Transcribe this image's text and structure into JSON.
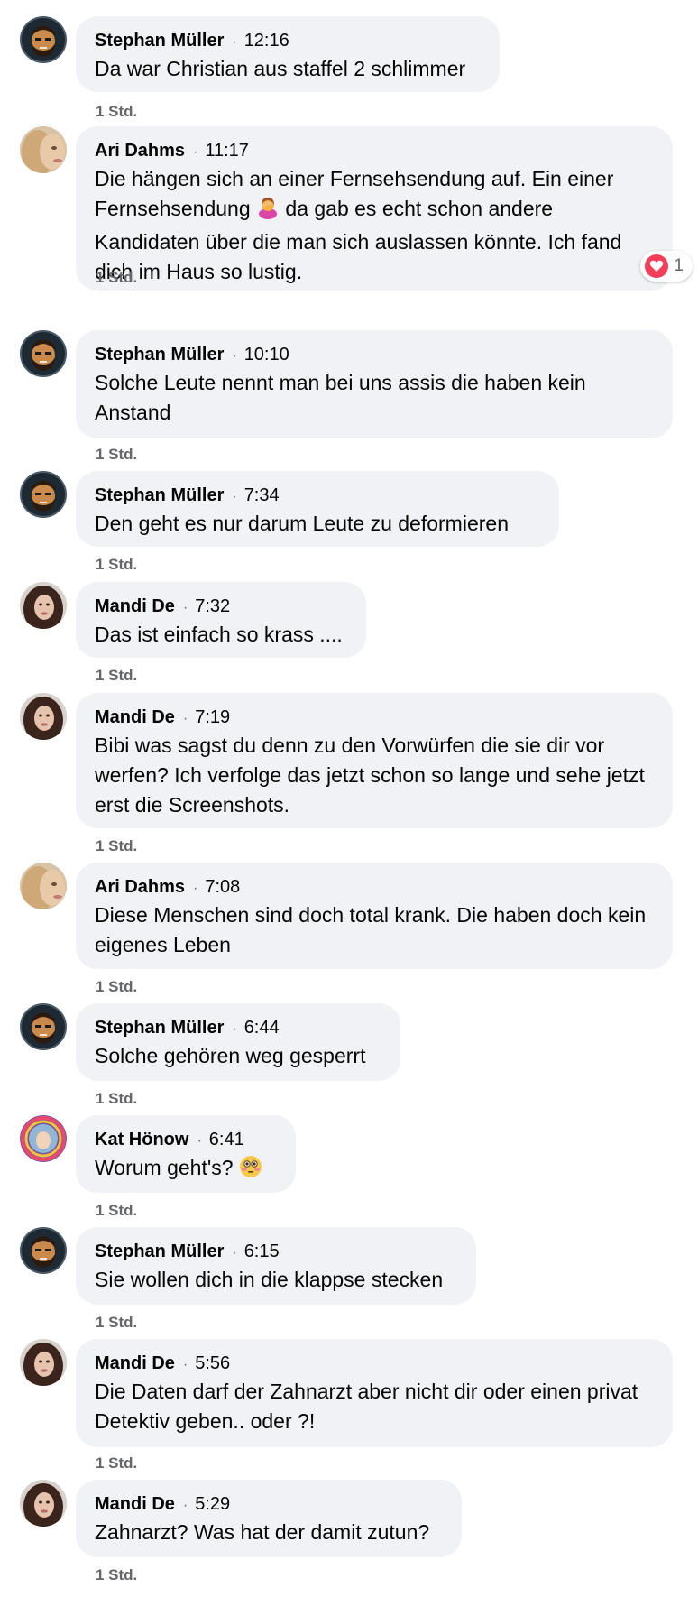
{
  "comments": [
    {
      "author": "Stephan Müller",
      "time": "12:16",
      "text": "Da war Christian aus staffel 2 schlimmer",
      "meta": "1 Std.",
      "avatar": "cartoon-man"
    },
    {
      "author": "Ari Dahms",
      "time": "11:17",
      "text_a": "Die hängen sich an einer Fernsehsendung auf. Ein einer Fernsehsendung ",
      "emoji": "woman-facepalming",
      "text_b": " da gab es echt schon andere Kandidaten über die man sich auslassen könnte. Ich fand dich im Haus so lustig.",
      "meta": "1 Std.",
      "reaction_count": "1",
      "avatar": "blonde-woman"
    },
    {
      "author": "Stephan Müller",
      "time": "10:10",
      "text": "Solche Leute nennt man bei uns assis die haben kein Anstand",
      "meta": "1 Std.",
      "avatar": "cartoon-man"
    },
    {
      "author": "Stephan Müller",
      "time": "7:34",
      "text": "Den geht es nur darum Leute zu deformieren",
      "meta": "1 Std.",
      "avatar": "cartoon-man"
    },
    {
      "author": "Mandi De",
      "time": "7:32",
      "text": "Das ist einfach so krass ....",
      "meta": "1 Std.",
      "avatar": "dark-hair-woman"
    },
    {
      "author": "Mandi De",
      "time": "7:19",
      "text": "Bibi was sagst du denn zu den Vorwürfen die sie dir vor werfen? Ich verfolge das jetzt schon so lange und sehe jetzt erst die Screenshots.",
      "meta": "1 Std.",
      "avatar": "dark-hair-woman"
    },
    {
      "author": "Ari Dahms",
      "time": "7:08",
      "text": "Diese Menschen sind doch total krank. Die haben doch kein eigenes Leben",
      "meta": "1 Std.",
      "avatar": "blonde-woman"
    },
    {
      "author": "Stephan Müller",
      "time": "6:44",
      "text": "Solche gehören weg gesperrt",
      "meta": "1 Std.",
      "avatar": "cartoon-man"
    },
    {
      "author": "Kat Hönow",
      "time": "6:41",
      "text": "Worum geht's?",
      "emoji": "flushed-face",
      "meta": "1 Std.",
      "avatar": "colorful-ring"
    },
    {
      "author": "Stephan Müller",
      "time": "6:15",
      "text": "Sie wollen dich in die klappse stecken",
      "meta": "1 Std.",
      "avatar": "cartoon-man"
    },
    {
      "author": "Mandi De",
      "time": "5:56",
      "text": "Die Daten darf der Zahnarzt aber nicht dir oder einen privat Detektiv geben.. oder ?!",
      "meta": "1 Std.",
      "avatar": "dark-hair-woman"
    },
    {
      "author": "Mandi De",
      "time": "5:29",
      "text": "Zahnarzt? Was hat der damit zutun?",
      "meta": "1 Std.",
      "avatar": "dark-hair-woman"
    }
  ],
  "colors": {
    "bubble": "#f0f2f5",
    "meta": "#65676b",
    "heart": "#f33e58"
  }
}
